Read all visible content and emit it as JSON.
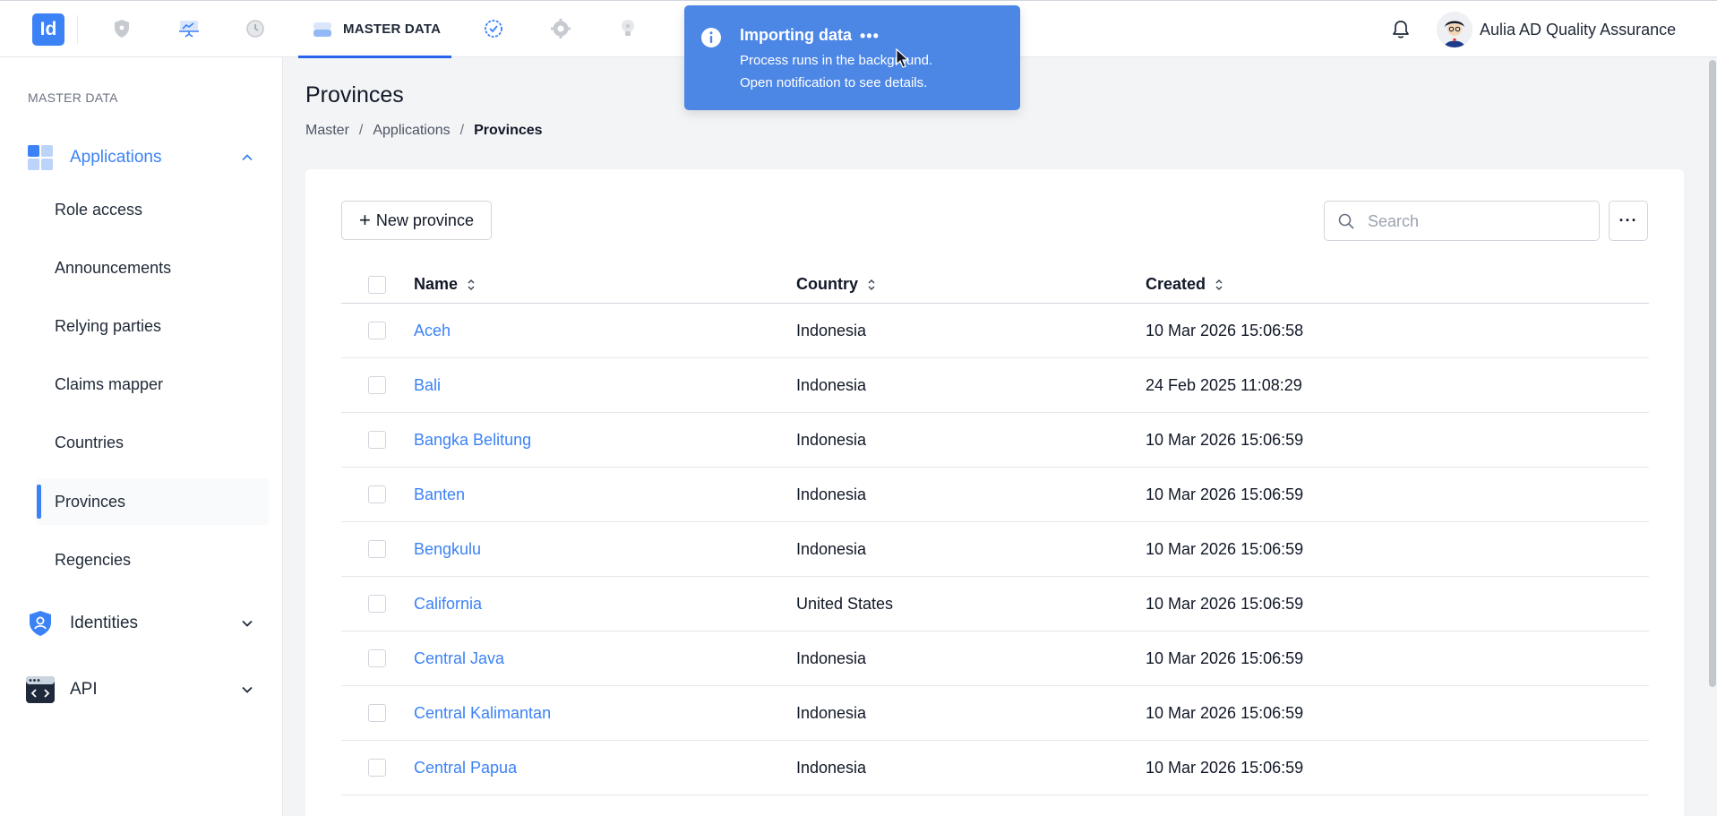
{
  "topbar": {
    "logo_text": "Id",
    "active_nav_label": "MASTER DATA",
    "nav_icons": [
      "shield-icon",
      "presentation-chart-icon",
      "history-clock-icon",
      "database-icon",
      "badge-check-icon",
      "gear-icon",
      "lightbulb-icon"
    ],
    "user_name": "Aulia AD Quality Assurance"
  },
  "toast": {
    "title": "Importing data",
    "dots": "•••",
    "line1": "Process runs in the background.",
    "line2": "Open notification to see details.",
    "color": "#4c87e6"
  },
  "sidebar": {
    "heading": "MASTER DATA",
    "groups": [
      {
        "label": "Applications",
        "icon": "grid-icon",
        "open": true,
        "items": [
          {
            "label": "Role access"
          },
          {
            "label": "Announcements"
          },
          {
            "label": "Relying parties"
          },
          {
            "label": "Claims mapper"
          },
          {
            "label": "Countries"
          },
          {
            "label": "Provinces",
            "active": true
          },
          {
            "label": "Regencies"
          }
        ]
      },
      {
        "label": "Identities",
        "icon": "shield-user-icon",
        "open": false
      },
      {
        "label": "API",
        "icon": "code-window-icon",
        "open": false
      }
    ]
  },
  "page": {
    "title": "Provinces",
    "breadcrumb": [
      "Master",
      "Applications",
      "Provinces"
    ],
    "new_button_label": "New province",
    "search_placeholder": "Search",
    "more_label": "···"
  },
  "table": {
    "columns": [
      "Name",
      "Country",
      "Created"
    ],
    "rows": [
      {
        "name": "Aceh",
        "country": "Indonesia",
        "created": "10 Mar 2026 15:06:58"
      },
      {
        "name": "Bali",
        "country": "Indonesia",
        "created": "24 Feb 2025 11:08:29"
      },
      {
        "name": "Bangka Belitung",
        "country": "Indonesia",
        "created": "10 Mar 2026 15:06:59"
      },
      {
        "name": "Banten",
        "country": "Indonesia",
        "created": "10 Mar 2026 15:06:59"
      },
      {
        "name": "Bengkulu",
        "country": "Indonesia",
        "created": "10 Mar 2026 15:06:59"
      },
      {
        "name": "California",
        "country": "United States",
        "created": "10 Mar 2026 15:06:59"
      },
      {
        "name": "Central Java",
        "country": "Indonesia",
        "created": "10 Mar 2026 15:06:59"
      },
      {
        "name": "Central Kalimantan",
        "country": "Indonesia",
        "created": "10 Mar 2026 15:06:59"
      },
      {
        "name": "Central Papua",
        "country": "Indonesia",
        "created": "10 Mar 2026 15:06:59"
      }
    ]
  },
  "colors": {
    "accent": "#3b82f6",
    "active_tab_underline": "#2563eb",
    "link": "#3b82f6"
  }
}
